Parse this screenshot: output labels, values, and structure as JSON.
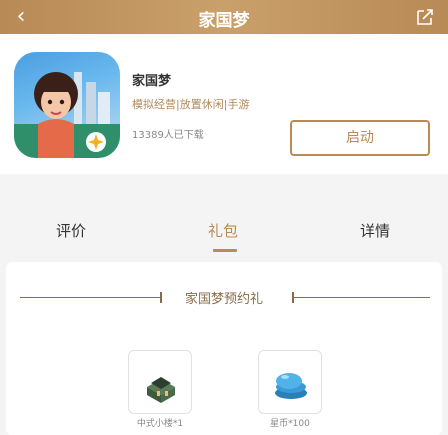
{
  "header": {
    "title": "家国梦",
    "back_icon": "back-arrow-icon",
    "share_icon": "share-icon"
  },
  "app": {
    "name": "家国梦",
    "description": "模拟经营|放置休闲|手游",
    "downloads": "13389人已下载",
    "launch_label": "启动",
    "icon": "app-icon-jiaguomeng"
  },
  "tabs": [
    {
      "label": "评价",
      "active": false
    },
    {
      "label": "礼包",
      "active": true
    },
    {
      "label": "详情",
      "active": false
    }
  ],
  "gift_section": {
    "title": "家国梦预约礼",
    "items": [
      {
        "label": "中式小楼*1",
        "icon": "building-icon"
      },
      {
        "label": "星币*100",
        "icon": "star-coin-icon"
      }
    ]
  },
  "colors": {
    "accent": "#b88a55",
    "section": "#8a6a4a"
  }
}
